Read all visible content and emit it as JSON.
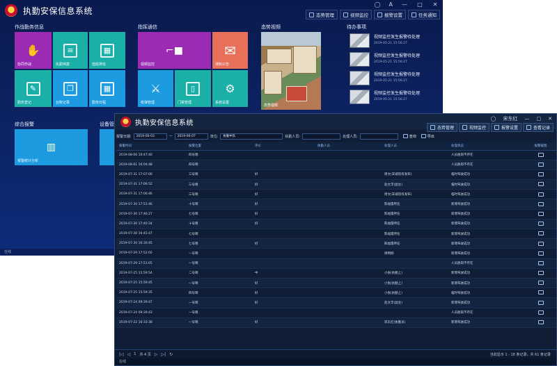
{
  "app": {
    "title": "执勤安保信息系统"
  },
  "back_window": {
    "user": "A",
    "win_controls": [
      "—",
      "□",
      "✕"
    ],
    "toolbar": [
      {
        "label": "态势管理",
        "icon": "monitor-icon"
      },
      {
        "label": "视频监控",
        "icon": "camera-icon"
      },
      {
        "label": "报警设置",
        "icon": "alarm-icon"
      },
      {
        "label": "任务通知",
        "icon": "bell-icon"
      }
    ],
    "sections": {
      "duty": "作战勤务信息",
      "command": "指挥通信",
      "panorama": "态势视频",
      "todo": "待办事项",
      "stats": "综合报警",
      "device": "设备管理"
    },
    "tiles": {
      "cooperate": "协同作战",
      "record": "执勤档案",
      "calendar1": "值班排班",
      "edit": "勤务登记",
      "copy": "台账记录",
      "calendar2": "勤务日程",
      "video": "视频监控",
      "mail": "通知公告",
      "weapon": "枪弹管理",
      "door": "门禁管理",
      "settings": "系统设置",
      "photo": "态势视频",
      "stats": "报警统计分析"
    },
    "todos": [
      {
        "title": "视频监控发生报警待处理",
        "time": "2019-05-21 15:56:27"
      },
      {
        "title": "视频监控发生报警待处理",
        "time": "2019-05-21 15:56:27"
      },
      {
        "title": "视频监控发生报警待处理",
        "time": "2019-05-21 15:56:27"
      },
      {
        "title": "视频监控发生报警待处理",
        "time": "2019-05-21 15:56:27"
      }
    ],
    "status": "在线"
  },
  "front_window": {
    "user": "宋东红",
    "toolbar": [
      {
        "label": "态势管理",
        "icon": "monitor-icon"
      },
      {
        "label": "视频监控",
        "icon": "camera-icon"
      },
      {
        "label": "报警设置",
        "icon": "alarm-icon"
      },
      {
        "label": "查看记录",
        "icon": "list-icon"
      }
    ],
    "filters": {
      "date_label": "报警日期:",
      "date_from": "2019-06-03",
      "date_to": "2019-06-07",
      "unit_label": "单位:",
      "unit_value": "执勤中队",
      "person_label": "执勤人员:",
      "person_value": "",
      "handler_label": "处理人员:",
      "handler_value": "",
      "search_label": "查询",
      "export_label": "导出"
    },
    "columns": [
      "报警时间",
      "报警位置",
      "评价",
      "执勤人员",
      "处理人员",
      "处理状态",
      "报警截图"
    ],
    "rows": [
      [
        "2019-08-06 10:47:40",
        "四号哨",
        "",
        "",
        "",
        "人员脱岗不存在"
      ],
      [
        "2019-08-01 16:04:48",
        "四号哨",
        "",
        "",
        "",
        "人员脱岗不存在"
      ],
      [
        "2019-07-31 17:07:00",
        "三号哨",
        "好",
        "",
        "周文(宋城现有发布)",
        "临时驾驶成功"
      ],
      [
        "2019-07-31 17:06:52",
        "三号哨",
        "好",
        "",
        "赵文丰(副主)",
        "临时驾驶成功"
      ],
      [
        "2019-07-31 17:06:46",
        "三号哨",
        "好",
        "",
        "周文(宋城现有发布)",
        "临时驾驶成功"
      ],
      [
        "2019-07-30 17:51:46",
        "十号哨",
        "好",
        "",
        "陈福雷所任",
        "新增驾驶成功"
      ],
      [
        "2019-07-30 17:46:27",
        "七号哨",
        "好",
        "",
        "陈福雷所任",
        "新增驾驶成功"
      ],
      [
        "2019-07-30 17:40:34",
        "十号哨",
        "好",
        "",
        "陈福雷所任",
        "新增驾驶成功"
      ],
      [
        "2019-07-30 16:45:47",
        "七号哨",
        "",
        "",
        "陈福雷所任",
        "新增驾驶成功"
      ],
      [
        "2019-07-30 16:30:45",
        "七号哨",
        "好",
        "",
        "陈福雷所任",
        "新增驾驶成功"
      ],
      [
        "2019-07-29 17:52:02",
        "一号哨",
        "",
        "",
        "谢明刚",
        "新增驾驶成功"
      ],
      [
        "2019-07-29 17:51:05",
        "一号哨",
        "",
        "",
        "",
        "人员脱岗不存在"
      ],
      [
        "2019-07-25 15:59:54",
        "二号哨",
        "中",
        "",
        "小张(执勤上)",
        "新增驾驶成功"
      ],
      [
        "2019-07-25 15:59:45",
        "一号哨",
        "好",
        "",
        "小张(执勤上)",
        "新增驾驶成功"
      ],
      [
        "2019-07-25 15:59:35",
        "四号哨",
        "好",
        "",
        "小张(执勤上)",
        "临时驾驶成功"
      ],
      [
        "2019-07-24 09:39:47",
        "一号哨",
        "好",
        "",
        "赵文丰(副主)",
        "新增驾驶成功"
      ],
      [
        "2019-07-24 09:39:43",
        "一号哨",
        "",
        "",
        "",
        "人员脱岗不存在"
      ],
      [
        "2019-07-22 16:33:38",
        "一号哨",
        "好",
        "",
        "宋东红(执勤员)",
        "新增驾驶成功"
      ]
    ],
    "pager": {
      "page": "1",
      "total": "共 4 页",
      "summary": "当前显示 1 - 18 条记录，共 61 条记录"
    },
    "status": "在线"
  }
}
